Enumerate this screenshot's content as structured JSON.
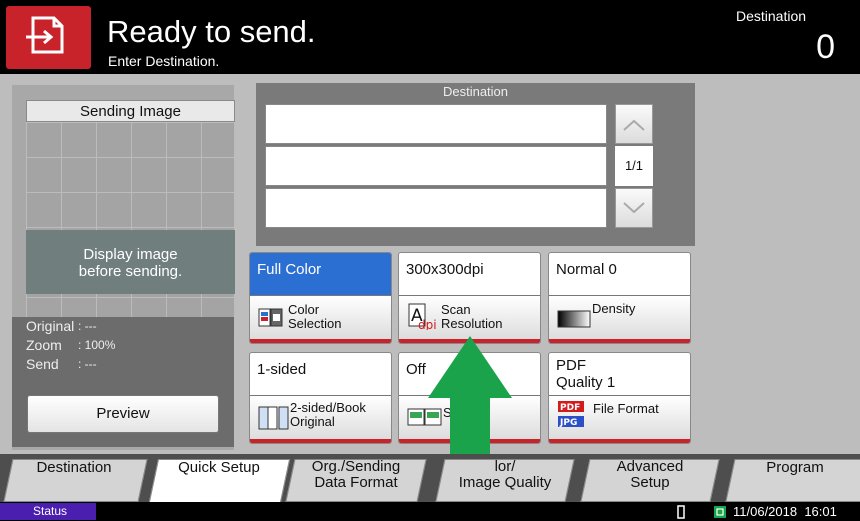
{
  "header": {
    "title": "Ready to send.",
    "subtitle": "Enter Destination.",
    "destination_label": "Destination",
    "destination_count": "0"
  },
  "left_panel": {
    "sending_image_title": "Sending Image",
    "preview_message": "Display image\nbefore sending.",
    "info": [
      {
        "label": "Original",
        "value": ": ---"
      },
      {
        "label": "Zoom",
        "value": ": 100%"
      },
      {
        "label": "Send",
        "value": ": ---"
      }
    ],
    "preview_button": "Preview"
  },
  "destination_panel": {
    "title": "Destination",
    "page_indicator": "1/1"
  },
  "settings": [
    {
      "value": "Full Color",
      "label": "Color\nSelection",
      "icon": "color-selection-icon",
      "active": true
    },
    {
      "value": "300x300dpi",
      "label": "Scan\nResolution",
      "icon": "scan-resolution-icon",
      "active": false
    },
    {
      "value": "Normal 0",
      "label": "Density",
      "icon": "density-icon",
      "active": false
    },
    {
      "value": "1-sided",
      "label": "2-sided/Book\nOriginal",
      "icon": "duplex-original-icon",
      "active": false
    },
    {
      "value": "Off",
      "label": "S",
      "icon": "scan-option-icon",
      "active": false
    },
    {
      "value": "PDF\nQuality 1",
      "label": "File Format",
      "icon": "file-format-icon",
      "active": false
    }
  ],
  "tabs": [
    {
      "label": "Destination",
      "active": false
    },
    {
      "label": "Quick Setup",
      "active": true
    },
    {
      "label": "Org./Sending\nData Format",
      "active": false
    },
    {
      "label": "lor/\nImage Quality",
      "active": false
    },
    {
      "label": "Advanced\nSetup",
      "active": false
    },
    {
      "label": "Program",
      "active": false
    }
  ],
  "status_bar": {
    "status_label": "Status",
    "datetime": "11/06/2018  16:01"
  },
  "colors": {
    "accent_red": "#c8222a",
    "active_blue": "#2c6fd2",
    "arrow_green": "#1aa34a",
    "status_purple": "#4a1fb0"
  }
}
